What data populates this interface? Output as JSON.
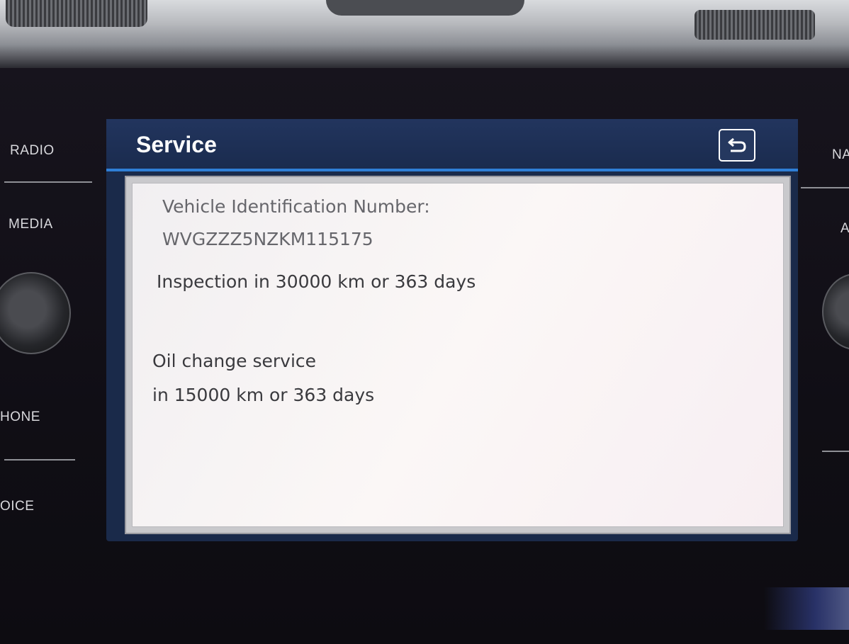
{
  "left_buttons": {
    "radio": "RADIO",
    "media": "MEDIA",
    "phone": "HONE",
    "voice": "OICE"
  },
  "right_buttons": {
    "nav": "NA",
    "app": "A"
  },
  "screen": {
    "title": "Service",
    "back_icon": "back-arrow-icon",
    "vin_label": "Vehicle Identification Number:",
    "vin_value": "WVGZZZ5NZKM115175",
    "inspection": "Inspection in 30000 km or 363 days",
    "oil_line1": "Oil change service",
    "oil_line2": "in 15000 km or 363 days"
  },
  "colors": {
    "title_bar": "#1a2b4e",
    "accent_line": "#2f7fd6",
    "content_bg": "#f6f3f4"
  }
}
